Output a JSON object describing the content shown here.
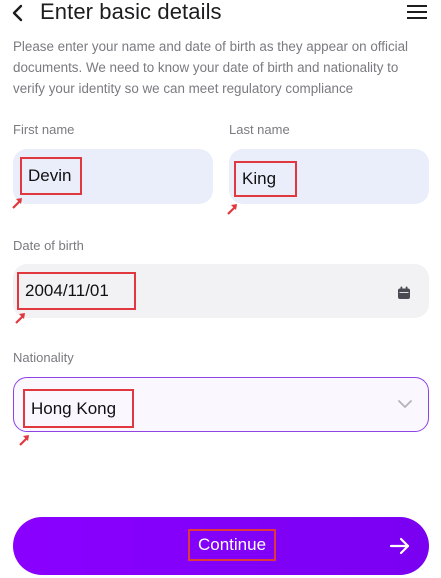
{
  "header": {
    "title": "Enter basic details",
    "back_icon": "chevron-left-icon",
    "menu_icon": "hamburger-menu-icon"
  },
  "intro_text": "Please enter your name and date of birth as they appear on official documents. We need to know your date of birth and nationality to verify your identity so we can meet regulatory compliance",
  "form": {
    "first_name": {
      "label": "First name",
      "value": "Devin"
    },
    "last_name": {
      "label": "Last name",
      "value": "King"
    },
    "date_of_birth": {
      "label": "Date of birth",
      "value": "2004/11/01",
      "icon": "calendar-icon"
    },
    "nationality": {
      "label": "Nationality",
      "value": "Hong Kong",
      "icon": "chevron-down-icon"
    }
  },
  "continue_button": {
    "label": "Continue",
    "icon": "arrow-right-icon"
  },
  "colors": {
    "accent": "#8a00ff",
    "field_bg": "#eaeefb",
    "annotation_red": "#e0383e"
  }
}
